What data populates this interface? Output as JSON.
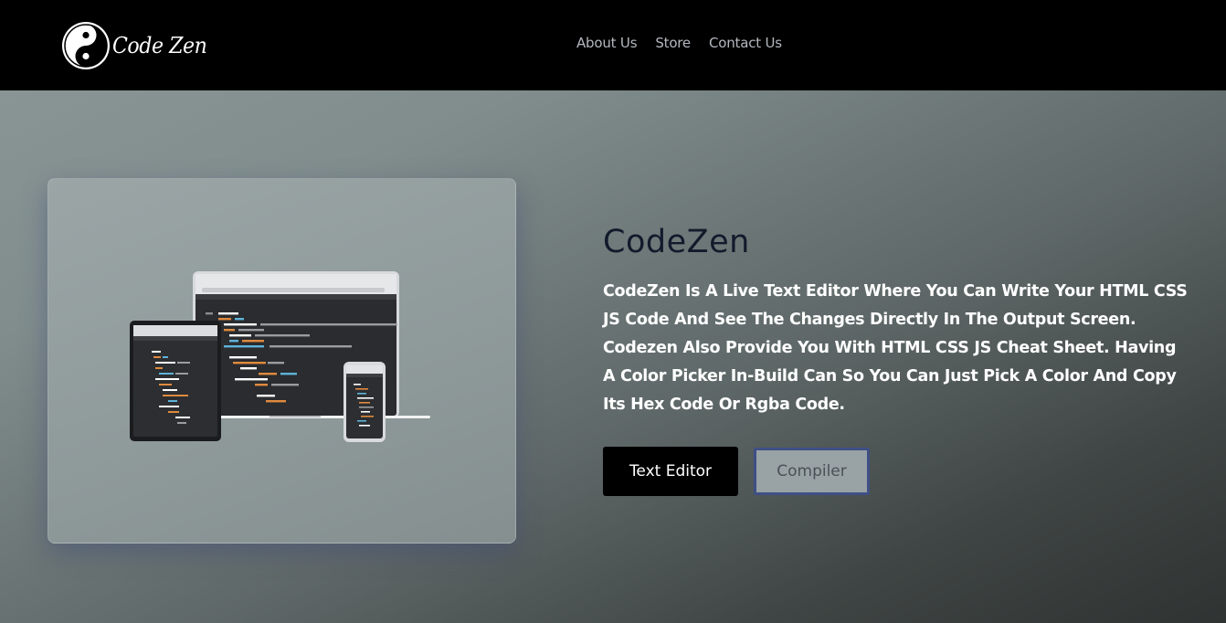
{
  "header": {
    "logo_text": "Code Zen",
    "nav": [
      {
        "label": "About Us"
      },
      {
        "label": "Store"
      },
      {
        "label": "Contact Us"
      }
    ]
  },
  "hero": {
    "image_icon": "devices-code-illustration",
    "title": "CodeZen",
    "description": "CodeZen Is A Live Text Editor Where You Can Write Your HTML CSS JS Code And See The Changes Directly In The Output Screen. Codezen Also Provide You With HTML CSS JS Cheat Sheet. Having A Color Picker In-Build Can So You Can Just Pick A Color And Copy Its Hex Code Or Rgba Code.",
    "primary_button": "Text Editor",
    "secondary_button": "Compiler"
  },
  "colors": {
    "navbar": "#000000",
    "title": "#121a2c",
    "primary_button_bg": "#000000",
    "secondary_button_border": "#3f4f86"
  }
}
